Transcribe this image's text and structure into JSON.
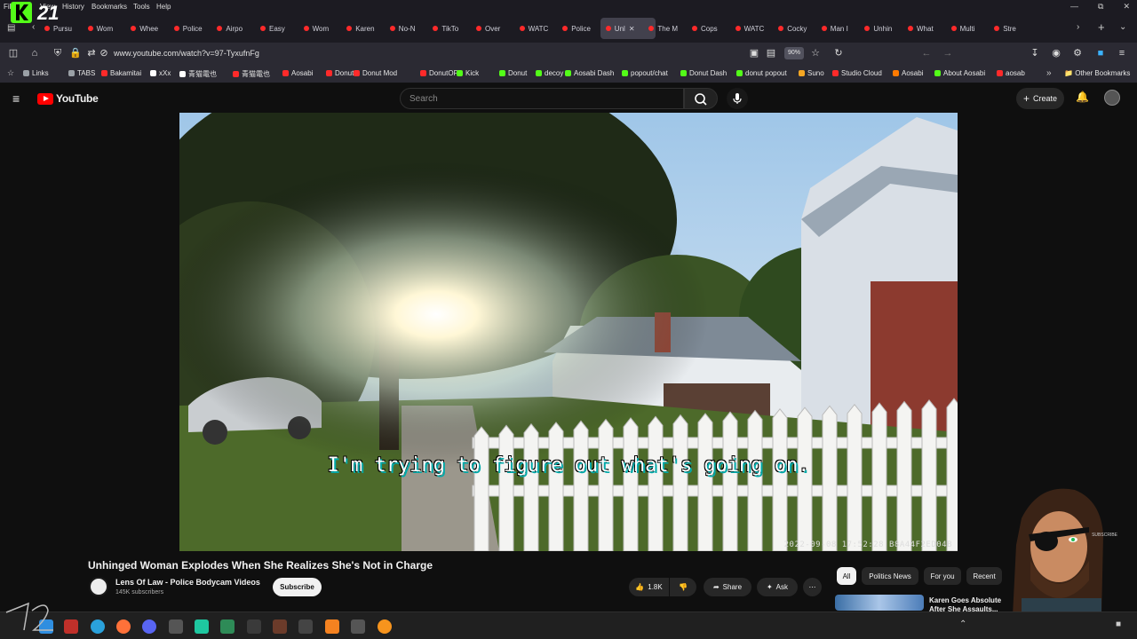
{
  "browser": {
    "menu": [
      "File",
      "View",
      "History",
      "Bookmarks",
      "Tools",
      "Help"
    ],
    "logo_text": "21",
    "tabs": [
      "Pursu",
      "Wom",
      "Whee",
      "Police",
      "Airpo",
      "Easy",
      "Wom",
      "Karen",
      "No-N",
      "TikTo",
      "Over",
      "WATC",
      "Police",
      "Unl",
      "The M",
      "Cops",
      "WATC",
      "Cocky",
      "Man I",
      "Unhin",
      "What",
      "Multi",
      "Stre"
    ],
    "active_tab_index": 13,
    "url": "www.youtube.com/watch?v=97-TyxufnFg",
    "zoom": "90%",
    "bookmarks": [
      {
        "label": "Links",
        "color": "#9aa0a6"
      },
      {
        "label": "TABS",
        "color": "#9aa0a6"
      },
      {
        "label": "Bakamitai",
        "color": "#ff2a2a"
      },
      {
        "label": "xXx",
        "color": "#ffffff"
      },
      {
        "label": "青猫電也",
        "color": "#ffffff"
      },
      {
        "label": "青猫電也",
        "color": "#ff2a2a"
      },
      {
        "label": "Aosabi",
        "color": "#ff2a2a"
      },
      {
        "label": "Donut",
        "color": "#ff2a2a"
      },
      {
        "label": "Donut Mod",
        "color": "#ff2a2a"
      },
      {
        "label": "DonutOP",
        "color": "#ff2a2a"
      },
      {
        "label": "Kick",
        "color": "#53fc18"
      },
      {
        "label": "Donut",
        "color": "#53fc18"
      },
      {
        "label": "decoy",
        "color": "#53fc18"
      },
      {
        "label": "Aosabi Dash",
        "color": "#53fc18"
      },
      {
        "label": "popout/chat",
        "color": "#53fc18"
      },
      {
        "label": "Donut Dash",
        "color": "#53fc18"
      },
      {
        "label": "donut popout",
        "color": "#53fc18"
      },
      {
        "label": "Suno",
        "color": "#f5a623"
      },
      {
        "label": "Studio Cloud",
        "color": "#ff2a2a"
      },
      {
        "label": "Aosabi",
        "color": "#ff7a00"
      },
      {
        "label": "About Aosabi",
        "color": "#53fc18"
      },
      {
        "label": "aosab",
        "color": "#ff2a2a"
      }
    ],
    "other_bookmarks": "Other Bookmarks"
  },
  "youtube": {
    "logo": "YouTube",
    "search_placeholder": "Search",
    "create_label": "Create",
    "caption": "I'm trying to figure out what's going on.",
    "timestamp": "2022-09-08  17:52:28   B8A44F2ED04B",
    "title": "Unhinged Woman Explodes When She Realizes She's Not in Charge",
    "channel": "Lens Of Law - Police Bodycam Videos",
    "subscribers": "145K subscribers",
    "subscribe_label": "Subscribe",
    "likes": "1.8K",
    "share_label": "Share",
    "ask_label": "Ask",
    "chips": [
      "All",
      "Politics News",
      "For you",
      "Recent"
    ],
    "rec_title": "Karen Goes Absolute After She Assaults..."
  },
  "overlay": {
    "subscribe_watermark": "SUBSCRIBE"
  },
  "colors": {
    "yt_red": "#ff0000",
    "browser_bg": "#1c1b22",
    "nav_bg": "#2b2a33",
    "caption_shadow": "#00aaaa"
  }
}
